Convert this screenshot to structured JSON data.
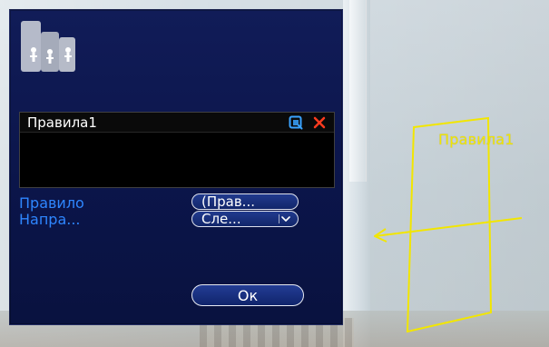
{
  "dialog": {
    "rules_header_title": "Правила1",
    "fields": {
      "rule_label": "Правило",
      "rule_value": "(Прав...",
      "direction_label": "Напра...",
      "direction_value": "Сле..."
    },
    "ok_label": "Ок"
  },
  "overlay": {
    "rule_name": "Правила1"
  },
  "colors": {
    "overlay_yellow": "#f2e600",
    "label_blue": "#2e86ff",
    "delete_red": "#ff3b1f",
    "edit_blue": "#3aa3ff"
  },
  "icons": {
    "people_counting": "people-counting-icon",
    "edit": "edit-icon",
    "delete": "close-icon",
    "dropdown": "chevron-down-icon"
  }
}
